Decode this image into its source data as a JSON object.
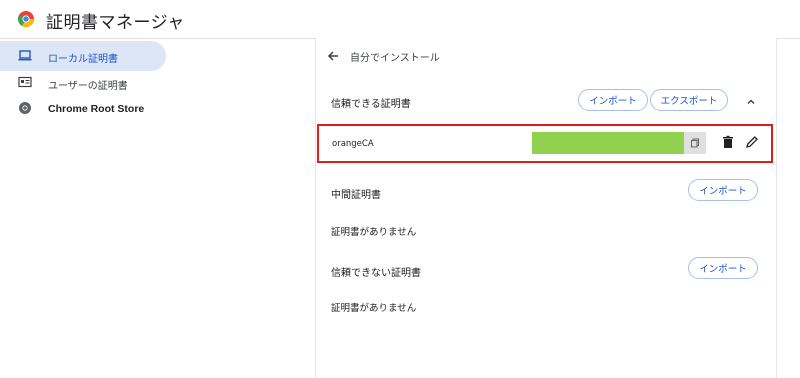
{
  "app": {
    "title": "証明書マネージャ",
    "logo_icon": "chrome-logo-icon"
  },
  "sidebar": {
    "items": [
      {
        "label": "ローカル証明書",
        "icon": "laptop-icon",
        "active": true
      },
      {
        "label": "ユーザーの証明書",
        "icon": "id-card-icon",
        "active": false
      },
      {
        "label": "Chrome Root Store",
        "icon": "chrome-icon",
        "active": false
      }
    ]
  },
  "main": {
    "back_label": "自分でインストール",
    "trusted": {
      "title": "信頼できる証明書",
      "import_label": "インポート",
      "export_label": "エクスポート",
      "cert_name": "orangeCA"
    },
    "intermediate": {
      "title": "中間証明書",
      "import_label": "インポート",
      "empty_text": "証明書がありません"
    },
    "untrusted": {
      "title": "信頼できない証明書",
      "import_label": "インポート",
      "empty_text": "証明書がありません"
    }
  },
  "colors": {
    "accent": "#1a56c8",
    "highlight_border": "#e01d1d",
    "hash_fill": "#92d050"
  }
}
